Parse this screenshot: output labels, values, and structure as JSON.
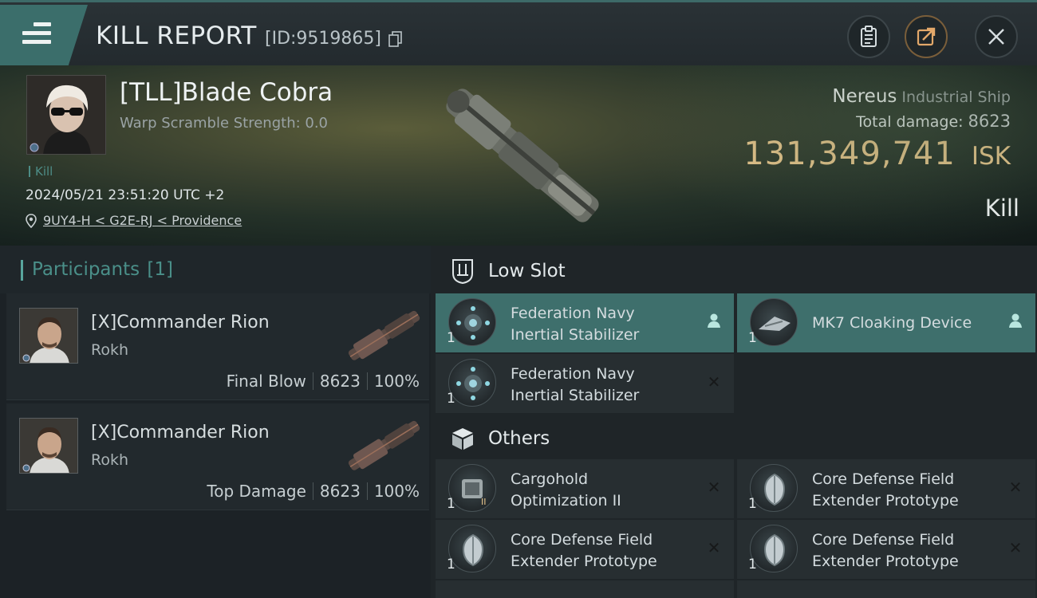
{
  "header": {
    "title": "KILL REPORT",
    "report_id": "[ID:9519865]",
    "icons": {
      "menu": "hamburger-icon",
      "copy": "copy-icon",
      "clipboard": "clipboard-icon",
      "share": "share-icon",
      "close": "close-icon"
    }
  },
  "victim": {
    "name": "[TLL]Blade Cobra",
    "warp_scramble": "Warp Scramble Strength: 0.0",
    "kill_tag": "Kill",
    "datetime": "2024/05/21 23:51:20 UTC +2",
    "location": "9UY4-H < G2E-RJ < Providence",
    "ship_name": "Nereus",
    "ship_class": "Industrial Ship",
    "total_damage_label": "Total damage:",
    "total_damage": "8623",
    "isk_value": "131,349,741",
    "isk_unit": "ISK",
    "result": "Kill"
  },
  "participants": {
    "label": "Participants",
    "count": "[1]",
    "list": [
      {
        "name": "[X]Commander Rion",
        "ship": "Rokh",
        "role": "Final Blow",
        "damage": "8623",
        "percent": "100%"
      },
      {
        "name": "[X]Commander Rion",
        "ship": "Rokh",
        "role": "Top Damage",
        "damage": "8623",
        "percent": "100%"
      }
    ]
  },
  "items": {
    "low_slot": {
      "label": "Low Slot",
      "cards": [
        {
          "qty": "1",
          "line1": "Federation Navy",
          "line2": "Inertial Stabilizer",
          "status": "person-icon"
        },
        {
          "qty": "1",
          "line1": "MK7 Cloaking Device",
          "line2": "",
          "status": "person-icon"
        },
        {
          "qty": "1",
          "line1": "Federation Navy",
          "line2": "Inertial Stabilizer",
          "status": "destroyed-x-icon"
        }
      ]
    },
    "others": {
      "label": "Others",
      "cards": [
        {
          "qty": "1",
          "line1": "Cargohold",
          "line2": "Optimization II",
          "status": "destroyed-x-icon"
        },
        {
          "qty": "1",
          "line1": "Core Defense Field",
          "line2": "Extender Prototype",
          "status": "destroyed-x-icon"
        },
        {
          "qty": "1",
          "line1": "Core Defense Field",
          "line2": "Extender Prototype",
          "status": "destroyed-x-icon"
        },
        {
          "qty": "1",
          "line1": "Core Defense Field",
          "line2": "Extender Prototype",
          "status": "destroyed-x-icon"
        }
      ]
    }
  },
  "colors": {
    "accent": "#3e6f6c",
    "isk": "#e7c58c",
    "panel": "#272e31"
  }
}
